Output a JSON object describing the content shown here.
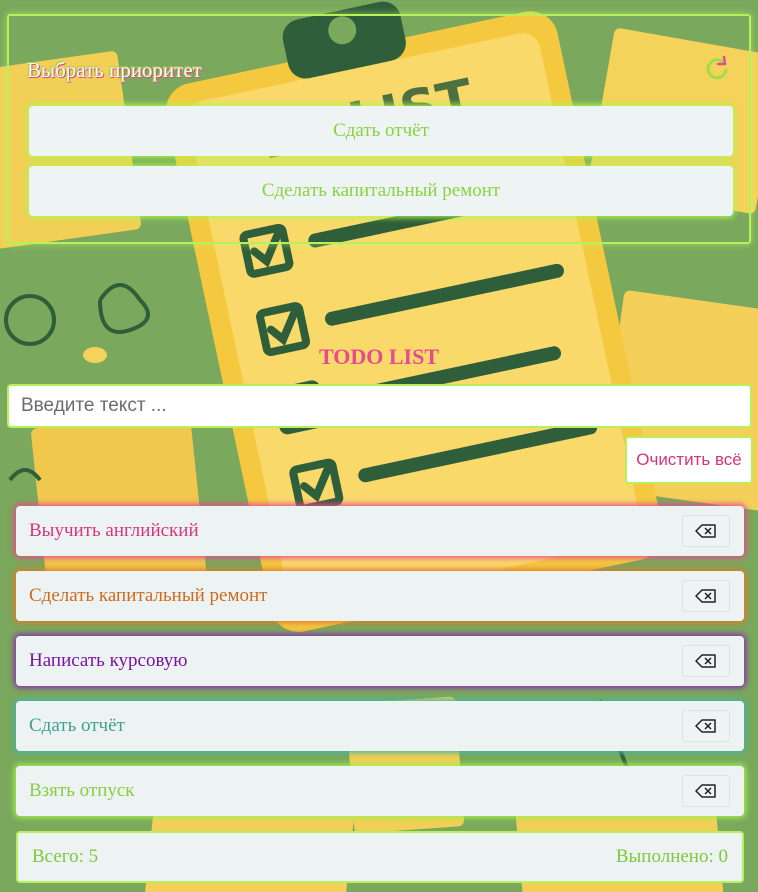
{
  "priority": {
    "title": "Выбрать приоритет",
    "refresh_icon": "refresh-icon",
    "items": [
      {
        "label": "Сдать отчёт"
      },
      {
        "label": "Сделать капитальный ремонт"
      }
    ]
  },
  "app": {
    "title": "TODO LIST",
    "input_placeholder": "Введите текст ...",
    "input_value": "",
    "clear_all_label": "Очистить всё"
  },
  "todos": [
    {
      "text": "Выучить английский",
      "color": "#d9357f"
    },
    {
      "text": "Сделать капитальный ремонт",
      "color": "#cf6a1d"
    },
    {
      "text": "Написать курсовую",
      "color": "#7a13a3"
    },
    {
      "text": "Сдать отчёт",
      "color": "#3fa08f"
    },
    {
      "text": "Взять отпуск",
      "color": "#86cf3c"
    }
  ],
  "delete_icon": "backspace-icon",
  "footer": {
    "total": "Всего: 5",
    "done": "Выполнено: 0"
  },
  "background_art_text": "TO LIST",
  "colors": {
    "accent_green": "#b6f05a",
    "title_pink": "#e94a8e",
    "panel_bg": "#edf3f3"
  }
}
